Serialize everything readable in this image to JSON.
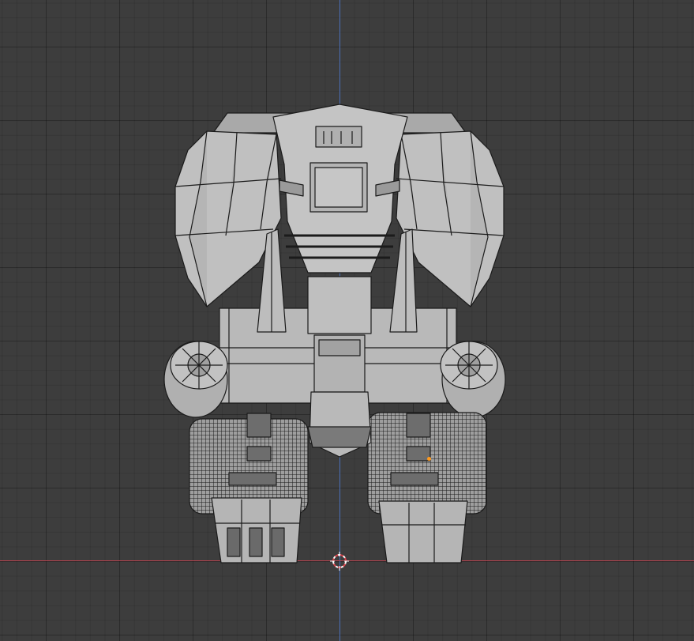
{
  "viewport": {
    "background": "#3d3d3d",
    "z_axis_color": "#4a6fb8",
    "x_axis_color": "#b8434f",
    "origin_color": "#ff9a1e"
  },
  "model": {
    "subject": "elephant-mech",
    "shading": "solid-wireframe",
    "base_color": "#b8b8b8",
    "wire_color": "#1b1b1b"
  },
  "icons": {
    "cursor": "3d-cursor-icon",
    "origin": "object-origin-icon"
  }
}
